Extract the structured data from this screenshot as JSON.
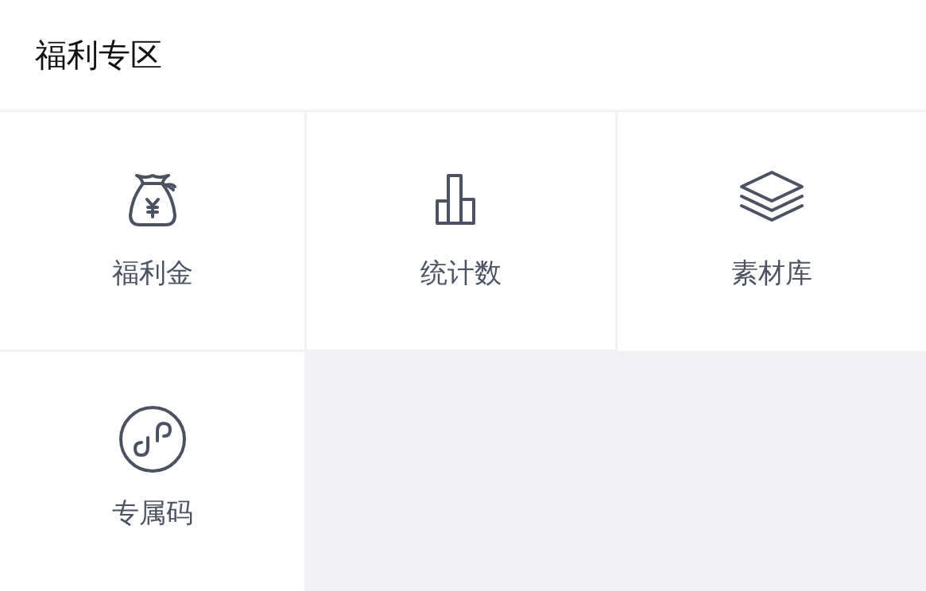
{
  "header": {
    "title": "福利专区"
  },
  "items": [
    {
      "label": "福利金"
    },
    {
      "label": "统计数"
    },
    {
      "label": "素材库"
    },
    {
      "label": "专属码"
    }
  ]
}
